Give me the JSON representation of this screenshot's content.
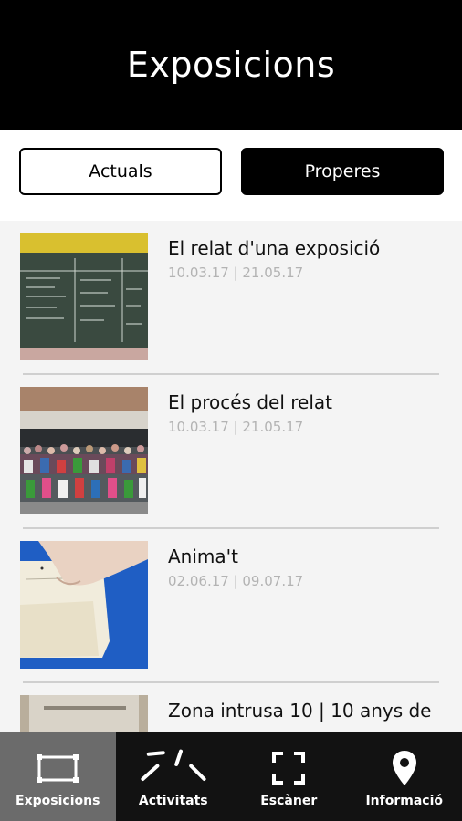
{
  "header": {
    "title": "Exposicions"
  },
  "segments": {
    "current_label": "Actuals",
    "upcoming_label": "Properes",
    "selected": "Properes"
  },
  "exhibitions": [
    {
      "title": "El relat d'una exposició",
      "dates": "10.03.17 | 21.05.17",
      "thumb": "blackboard-photo"
    },
    {
      "title": "El procés del relat",
      "dates": "10.03.17 | 21.05.17",
      "thumb": "group-photo"
    },
    {
      "title": "Anima't",
      "dates": "02.06.17 | 09.07.17",
      "thumb": "flipbook-photo"
    },
    {
      "title": "Zona intrusa 10 | 10 anys de",
      "dates": "",
      "thumb": "room-photo"
    }
  ],
  "tabbar": {
    "active": "Exposicions",
    "items": [
      {
        "label": "Exposicions",
        "icon": "frame-icon"
      },
      {
        "label": "Activitats",
        "icon": "activities-icon"
      },
      {
        "label": "Escàner",
        "icon": "scanner-icon"
      },
      {
        "label": "Informació",
        "icon": "location-pin-icon"
      }
    ]
  }
}
